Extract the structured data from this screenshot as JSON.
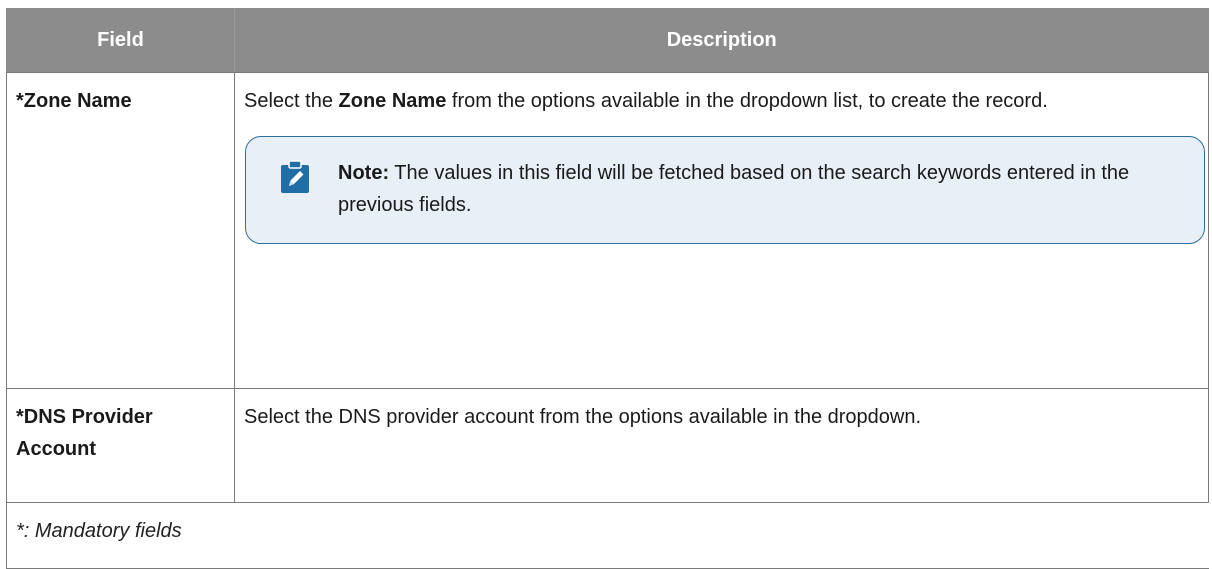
{
  "table": {
    "headers": [
      "Field",
      "Description"
    ],
    "rows": [
      {
        "field": "*Zone Name",
        "description": {
          "prefix": "Select the ",
          "bold": "Zone Name",
          "suffix": " from the options available in the dropdown list, to create the record."
        },
        "note": {
          "label": "Note:",
          "text": " The values in this field will be fetched based on the search keywords entered in the previous fields.",
          "icon": "pencil-note-icon"
        }
      },
      {
        "field": "*DNS Provider Account",
        "description": "Select the DNS provider account from the options available in the dropdown."
      }
    ],
    "footer": "*: Mandatory fields"
  },
  "colors": {
    "header_bg": "#8c8c8c",
    "note_bg": "#e9eff6",
    "note_border": "#2a6f9e",
    "note_icon": "#1f6fa6"
  }
}
